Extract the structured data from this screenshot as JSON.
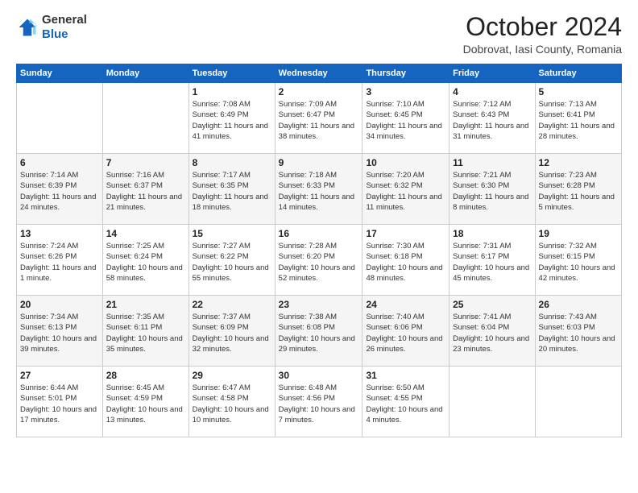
{
  "header": {
    "logo_line1": "General",
    "logo_line2": "Blue",
    "month": "October 2024",
    "location": "Dobrovat, Iasi County, Romania"
  },
  "days_of_week": [
    "Sunday",
    "Monday",
    "Tuesday",
    "Wednesday",
    "Thursday",
    "Friday",
    "Saturday"
  ],
  "weeks": [
    [
      {
        "day": "",
        "info": ""
      },
      {
        "day": "",
        "info": ""
      },
      {
        "day": "1",
        "info": "Sunrise: 7:08 AM\nSunset: 6:49 PM\nDaylight: 11 hours and 41 minutes."
      },
      {
        "day": "2",
        "info": "Sunrise: 7:09 AM\nSunset: 6:47 PM\nDaylight: 11 hours and 38 minutes."
      },
      {
        "day": "3",
        "info": "Sunrise: 7:10 AM\nSunset: 6:45 PM\nDaylight: 11 hours and 34 minutes."
      },
      {
        "day": "4",
        "info": "Sunrise: 7:12 AM\nSunset: 6:43 PM\nDaylight: 11 hours and 31 minutes."
      },
      {
        "day": "5",
        "info": "Sunrise: 7:13 AM\nSunset: 6:41 PM\nDaylight: 11 hours and 28 minutes."
      }
    ],
    [
      {
        "day": "6",
        "info": "Sunrise: 7:14 AM\nSunset: 6:39 PM\nDaylight: 11 hours and 24 minutes."
      },
      {
        "day": "7",
        "info": "Sunrise: 7:16 AM\nSunset: 6:37 PM\nDaylight: 11 hours and 21 minutes."
      },
      {
        "day": "8",
        "info": "Sunrise: 7:17 AM\nSunset: 6:35 PM\nDaylight: 11 hours and 18 minutes."
      },
      {
        "day": "9",
        "info": "Sunrise: 7:18 AM\nSunset: 6:33 PM\nDaylight: 11 hours and 14 minutes."
      },
      {
        "day": "10",
        "info": "Sunrise: 7:20 AM\nSunset: 6:32 PM\nDaylight: 11 hours and 11 minutes."
      },
      {
        "day": "11",
        "info": "Sunrise: 7:21 AM\nSunset: 6:30 PM\nDaylight: 11 hours and 8 minutes."
      },
      {
        "day": "12",
        "info": "Sunrise: 7:23 AM\nSunset: 6:28 PM\nDaylight: 11 hours and 5 minutes."
      }
    ],
    [
      {
        "day": "13",
        "info": "Sunrise: 7:24 AM\nSunset: 6:26 PM\nDaylight: 11 hours and 1 minute."
      },
      {
        "day": "14",
        "info": "Sunrise: 7:25 AM\nSunset: 6:24 PM\nDaylight: 10 hours and 58 minutes."
      },
      {
        "day": "15",
        "info": "Sunrise: 7:27 AM\nSunset: 6:22 PM\nDaylight: 10 hours and 55 minutes."
      },
      {
        "day": "16",
        "info": "Sunrise: 7:28 AM\nSunset: 6:20 PM\nDaylight: 10 hours and 52 minutes."
      },
      {
        "day": "17",
        "info": "Sunrise: 7:30 AM\nSunset: 6:18 PM\nDaylight: 10 hours and 48 minutes."
      },
      {
        "day": "18",
        "info": "Sunrise: 7:31 AM\nSunset: 6:17 PM\nDaylight: 10 hours and 45 minutes."
      },
      {
        "day": "19",
        "info": "Sunrise: 7:32 AM\nSunset: 6:15 PM\nDaylight: 10 hours and 42 minutes."
      }
    ],
    [
      {
        "day": "20",
        "info": "Sunrise: 7:34 AM\nSunset: 6:13 PM\nDaylight: 10 hours and 39 minutes."
      },
      {
        "day": "21",
        "info": "Sunrise: 7:35 AM\nSunset: 6:11 PM\nDaylight: 10 hours and 35 minutes."
      },
      {
        "day": "22",
        "info": "Sunrise: 7:37 AM\nSunset: 6:09 PM\nDaylight: 10 hours and 32 minutes."
      },
      {
        "day": "23",
        "info": "Sunrise: 7:38 AM\nSunset: 6:08 PM\nDaylight: 10 hours and 29 minutes."
      },
      {
        "day": "24",
        "info": "Sunrise: 7:40 AM\nSunset: 6:06 PM\nDaylight: 10 hours and 26 minutes."
      },
      {
        "day": "25",
        "info": "Sunrise: 7:41 AM\nSunset: 6:04 PM\nDaylight: 10 hours and 23 minutes."
      },
      {
        "day": "26",
        "info": "Sunrise: 7:43 AM\nSunset: 6:03 PM\nDaylight: 10 hours and 20 minutes."
      }
    ],
    [
      {
        "day": "27",
        "info": "Sunrise: 6:44 AM\nSunset: 5:01 PM\nDaylight: 10 hours and 17 minutes."
      },
      {
        "day": "28",
        "info": "Sunrise: 6:45 AM\nSunset: 4:59 PM\nDaylight: 10 hours and 13 minutes."
      },
      {
        "day": "29",
        "info": "Sunrise: 6:47 AM\nSunset: 4:58 PM\nDaylight: 10 hours and 10 minutes."
      },
      {
        "day": "30",
        "info": "Sunrise: 6:48 AM\nSunset: 4:56 PM\nDaylight: 10 hours and 7 minutes."
      },
      {
        "day": "31",
        "info": "Sunrise: 6:50 AM\nSunset: 4:55 PM\nDaylight: 10 hours and 4 minutes."
      },
      {
        "day": "",
        "info": ""
      },
      {
        "day": "",
        "info": ""
      }
    ]
  ]
}
